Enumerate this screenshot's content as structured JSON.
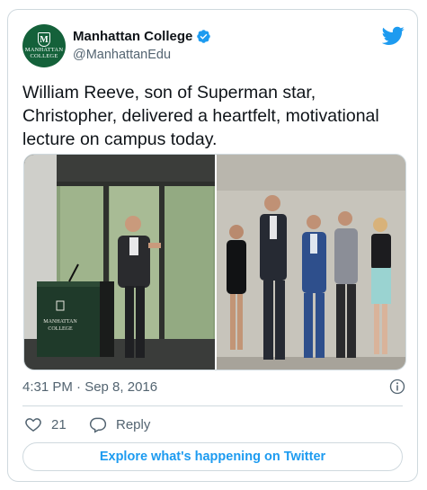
{
  "account": {
    "name": "Manhattan College",
    "handle": "@ManhattanEdu",
    "avatar_text_1": "MANHATTAN",
    "avatar_text_2": "COLLEGE",
    "avatar_monogram": "M",
    "verified": true
  },
  "tweet": {
    "text": "William Reeve, son of Superman star, Christopher, delivered a heartfelt, motivational lecture on campus today.",
    "timestamp": "4:31 PM · Sep 8, 2016"
  },
  "media": {
    "photos": [
      {
        "description_icon": "photo-lecture-podium",
        "podium_text_1": "MANHATTAN",
        "podium_text_2": "COLLEGE"
      },
      {
        "description_icon": "photo-group-portrait"
      }
    ]
  },
  "actions": {
    "like_count": "21",
    "reply_label": "Reply",
    "explore_label": "Explore what's happening on Twitter"
  },
  "colors": {
    "brand_blue": "#1d9bf0",
    "college_green": "#14613a",
    "muted_text": "#536471",
    "border": "#cfd9de"
  }
}
